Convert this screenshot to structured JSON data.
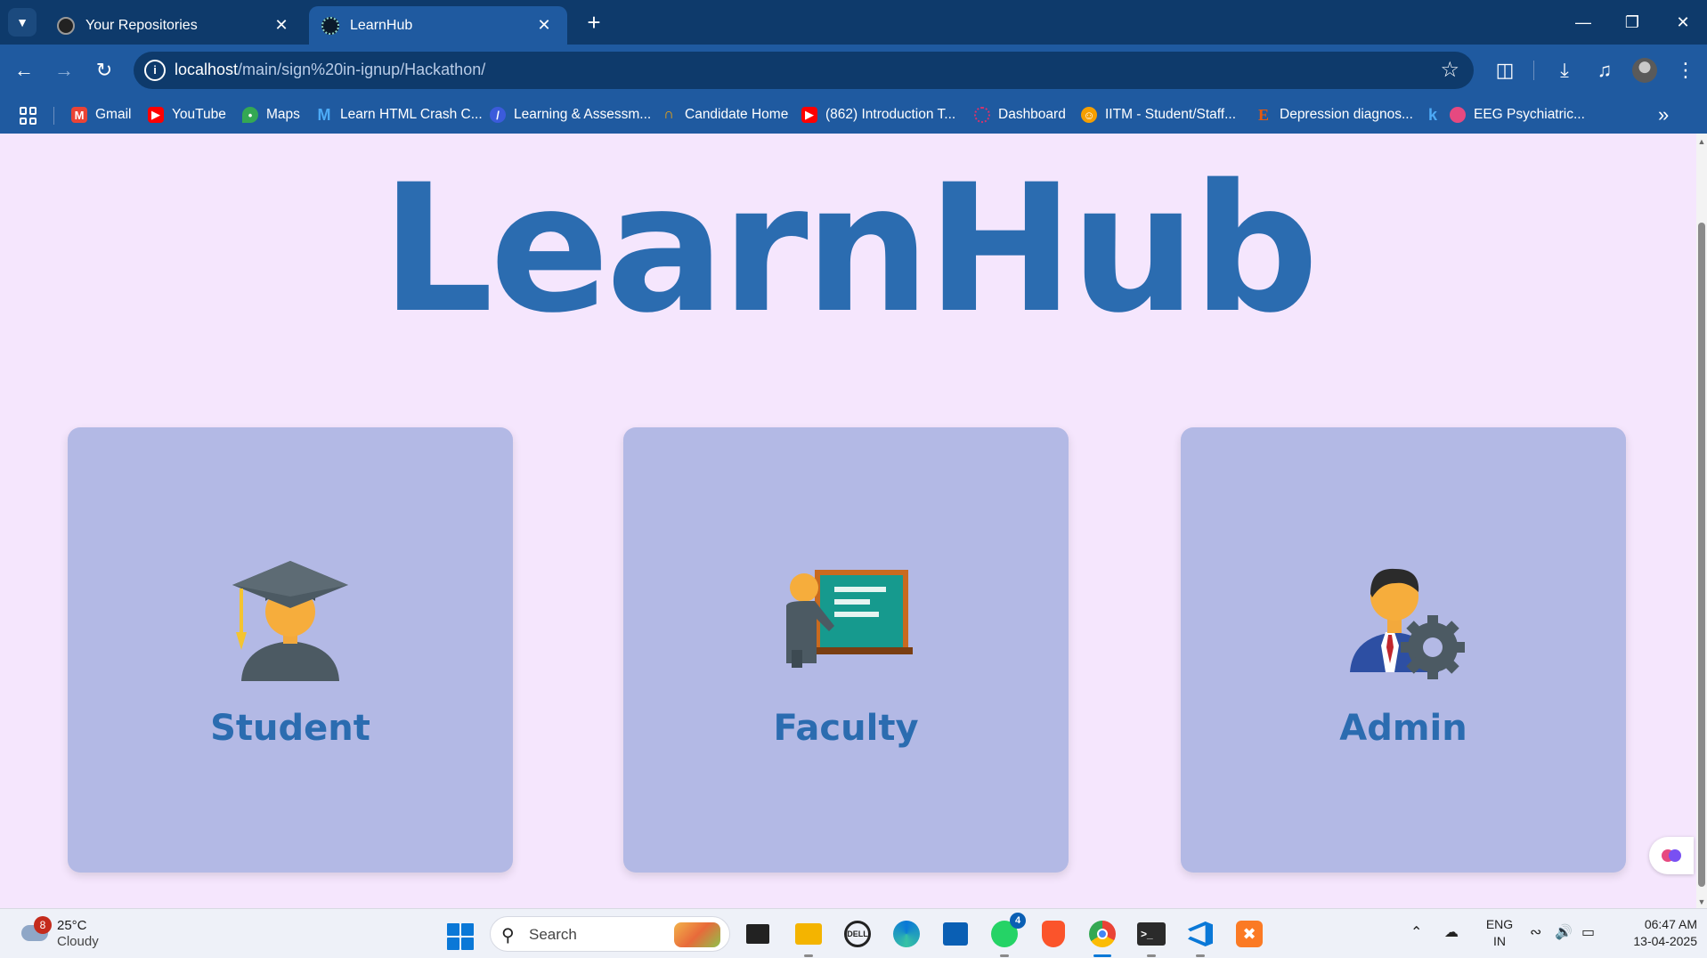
{
  "browser": {
    "tabs": [
      {
        "label": "Your Repositories",
        "active": false
      },
      {
        "label": "LearnHub",
        "active": true
      }
    ],
    "url_host": "localhost",
    "url_path": "/main/sign%20in-ignup/Hackathon/",
    "bookmarks": [
      {
        "label": "Gmail",
        "icon": "gmail-icon",
        "color": "#ea4335"
      },
      {
        "label": "YouTube",
        "icon": "youtube-icon",
        "color": "#ff0000"
      },
      {
        "label": "Maps",
        "icon": "maps-icon",
        "color": "#34a853"
      },
      {
        "label": "Learn HTML Crash C...",
        "icon": "m-icon",
        "color": "#1f5aa0"
      },
      {
        "label": "Learning & Assessm...",
        "icon": "learning-icon",
        "color": "#3b5bdb"
      },
      {
        "label": "Candidate Home",
        "icon": "rainbow-icon",
        "color": "#f6a609"
      },
      {
        "label": "(862) Introduction T...",
        "icon": "youtube-icon",
        "color": "#ff0000"
      },
      {
        "label": "Dashboard",
        "icon": "dashboard-icon",
        "color": "#d6336c"
      },
      {
        "label": "IITM - Student/Staff...",
        "icon": "iitm-icon",
        "color": "#f59f00"
      },
      {
        "label": "Depression diagnos...",
        "icon": "e-icon",
        "color": "#e8590c"
      },
      {
        "label": "",
        "icon": "k-icon",
        "color": "#4dabf7"
      },
      {
        "label": "EEG Psychiatric...",
        "icon": "brain-icon",
        "color": "#e64980"
      }
    ]
  },
  "page": {
    "logo": "LearnHub",
    "cards": [
      {
        "title": "Student",
        "icon": "graduate-icon"
      },
      {
        "title": "Faculty",
        "icon": "teacher-icon"
      },
      {
        "title": "Admin",
        "icon": "admin-gear-icon"
      }
    ]
  },
  "taskbar": {
    "weather_temp": "25°C",
    "weather_condition": "Cloudy",
    "weather_badge": "8",
    "search_label": "Search",
    "whatsapp_count": "4",
    "lang_line1": "ENG",
    "lang_line2": "IN",
    "time": "06:47 AM",
    "date": "13-04-2025"
  },
  "colors": {
    "titlebar": "#0e3a6b",
    "toolbar": "#1f5aa0",
    "page_bg": "#f5e6fd",
    "card_bg": "#b3b9e5",
    "brand": "#2b6cb0"
  }
}
